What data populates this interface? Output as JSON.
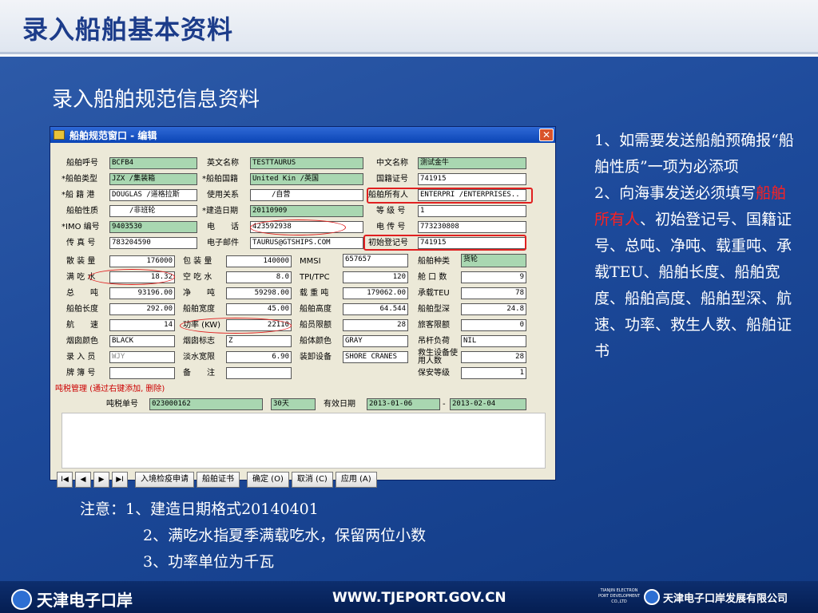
{
  "header": {
    "title": "录入船舶基本资料"
  },
  "subtitle": "录入船舶规范信息资料",
  "window": {
    "title": "船舶规范窗口 - 编辑",
    "close": "✕",
    "labels": {
      "call_sign": "船舶呼号",
      "ship_type": "*船舶类型",
      "port": "*船 籍 港",
      "nature": "船舶性质",
      "imo": "*IMO 编号",
      "fax": "传 真 号",
      "en_name": "英文名称",
      "flag": "*船舶国籍",
      "usage": "使用关系",
      "build_date": "*建造日期",
      "phone": "电　　话",
      "email": "电子邮件",
      "cn_name": "中文名称",
      "nationality_cert": "国籍证号",
      "owner": "船舶所有人",
      "grade": "等 级 号",
      "telegraph": "电 传 号",
      "initial_reg": "初始登记号",
      "bulk": "散 装 量",
      "bale": "包 装 量",
      "mmsi": "MMSI",
      "ship_kind": "船舶种类",
      "full_draft": "满 吃 水",
      "empty_draft": "空 吃 水",
      "tpi": "TPI/TPC",
      "hatch": "舱 口 数",
      "gross": "总　　吨",
      "net": "净　　吨",
      "dwt": "载 重 吨",
      "teu": "承载TEU",
      "length": "船舶长度",
      "width": "船舶宽度",
      "height": "船舶高度",
      "depth": "船舶型深",
      "speed": "航　　速",
      "power": "功率 (KW)",
      "crew_limit": "船员限额",
      "pax_limit": "旅客限额",
      "funnel": "烟囱颜色",
      "funnel_mark": "烟囱标志",
      "hull": "船体颜色",
      "boom": "吊杆负荷",
      "entry": "录 入 员",
      "fw_width": "淡水宽限",
      "loader": "装卸设备",
      "lifesave": "救生设备使用人数",
      "plate": "牌 簿 号",
      "remark": "备　　注",
      "security": "保安等级"
    },
    "values": {
      "call_sign": "BCFB4",
      "ship_type": "JZX /集装箱",
      "port": "DOUGLAS /道格拉斯",
      "nature": "/非班轮",
      "imo": "9403530",
      "fax": "783204590",
      "en_name": "TESTTAURUS",
      "flag": "United Kin /英国",
      "usage": "/自营",
      "build_date": "20110909",
      "phone": "423592938",
      "email": "TAURUS@GTSHIPS.COM",
      "cn_name": "测试金牛",
      "nationality_cert": "741915",
      "owner": "ENTERPRI /ENTERPRISES..",
      "grade": "1",
      "telegraph": "773230808",
      "initial_reg": "741915",
      "bulk": "176000",
      "bale": "140000",
      "mmsi": "657657",
      "ship_kind": "货轮",
      "full_draft": "18.32",
      "empty_draft": "8.0",
      "tpi": "120",
      "hatch": "9",
      "gross": "93196.00",
      "net": "59298.00",
      "dwt": "179062.00",
      "teu": "78",
      "length": "292.00",
      "width": "45.00",
      "height": "64.544",
      "depth": "24.8",
      "speed": "14",
      "power": "22110",
      "crew_limit": "28",
      "pax_limit": "0",
      "funnel": "BLACK",
      "funnel_mark": "Z",
      "hull": "GRAY",
      "boom": "NIL",
      "entry": "WJY",
      "fw_width": "6.90",
      "loader": "SHORE CRANES",
      "lifesave": "28",
      "plate": "",
      "remark": "",
      "security": "1"
    },
    "tax": {
      "legend": "吨税管理 (通过右键添加, 删除)",
      "no_label": "吨税单号",
      "no_value": "023000162",
      "days": "30天",
      "valid_label": "有效日期",
      "from": "2013-01-06",
      "dash": "-",
      "to": "2013-02-04"
    },
    "buttons": {
      "first": "I◀",
      "prev": "◀",
      "next": "▶",
      "last": "▶I",
      "quarantine": "入境检疫申请",
      "cert": "船舶证书",
      "ok": "确定 (O)",
      "cancel": "取消 (C)",
      "apply": "应用 (A)"
    }
  },
  "notes": {
    "n1": "1、如需要发送船舶预确报“船舶性质”一项为必添项",
    "n2a": "2、向海事发送必须填写",
    "n2red": "船舶所有人",
    "n2b": "、初始登记号、国籍证号、总吨、净吨、载重吨、承载TEU、船舶长度、船舶宽度、船舶高度、船舶型深、航速、功率、救生人数、船舶证书"
  },
  "bottom_notes": {
    "l1": "注意：1、建造日期格式20140401",
    "l2": "2、满吃水指夏季满载吃水，保留两位小数",
    "l3": "3、功率单位为千瓦"
  },
  "footer": {
    "left_logo": "天津电子口岸",
    "url": "WWW.TJEPORT.GOV.CN",
    "small": "TIANJIN ELECTRON PORT DEVELOPMENT CO.,LTD",
    "company": "天津电子口岸发展有限公司"
  }
}
